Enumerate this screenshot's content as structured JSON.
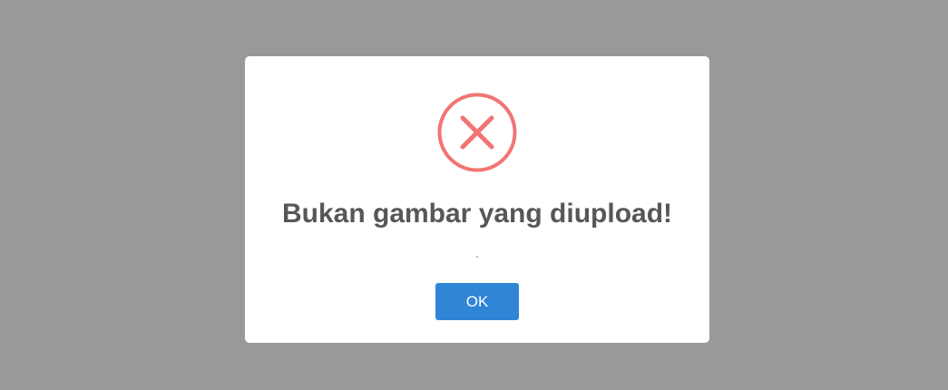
{
  "dialog": {
    "icon": "error-x-icon",
    "title": "Bukan gambar yang diupload!",
    "text": ".",
    "confirm_label": "OK"
  },
  "colors": {
    "backdrop": "#999999",
    "modal_bg": "#ffffff",
    "error_icon": "#f27474",
    "title": "#575757",
    "confirm_button": "#3085d6"
  }
}
